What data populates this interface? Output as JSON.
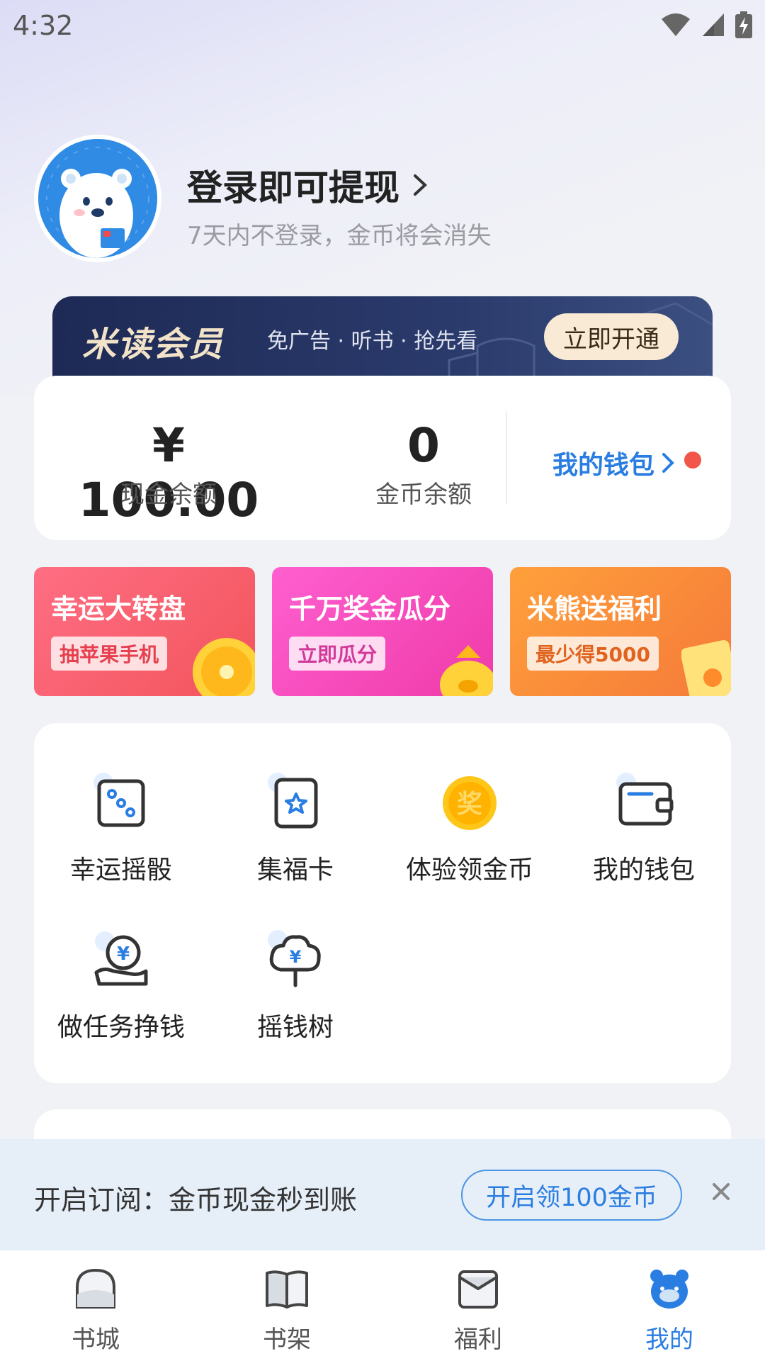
{
  "status_bar": {
    "time": "4:32"
  },
  "profile": {
    "login_title": "登录即可提现",
    "login_subtitle": "7天内不登录，金币将会消失"
  },
  "vip": {
    "title": "米读会员",
    "subtitle": "免广告 · 听书 · 抢先看",
    "button": "立即开通"
  },
  "balance": {
    "cash_amount": "¥ 100.00",
    "cash_label": "现金余额",
    "coin_amount": "0",
    "coin_label": "金币余额",
    "wallet_link": "我的钱包"
  },
  "promos": [
    {
      "title": "幸运大转盘",
      "tag": "抽苹果手机"
    },
    {
      "title": "千万奖金瓜分",
      "tag": "立即瓜分"
    },
    {
      "title": "米熊送福利",
      "tag": "最少得5000"
    }
  ],
  "features": [
    {
      "label": "幸运摇骰",
      "icon": "dice-icon"
    },
    {
      "label": "集福卡",
      "icon": "fortune-card-icon"
    },
    {
      "label": "体验领金币",
      "icon": "coin-reward-icon"
    },
    {
      "label": "我的钱包",
      "icon": "wallet-icon"
    },
    {
      "label": "做任务挣钱",
      "icon": "task-money-icon"
    },
    {
      "label": "摇钱树",
      "icon": "money-tree-icon"
    }
  ],
  "subscription": {
    "text": "开启订阅：金币现金秒到账",
    "button": "开启领100金币"
  },
  "nav": [
    {
      "label": "书城",
      "icon": "bookstore-icon"
    },
    {
      "label": "书架",
      "icon": "bookshelf-icon"
    },
    {
      "label": "福利",
      "icon": "welfare-icon"
    },
    {
      "label": "我的",
      "icon": "profile-bear-icon"
    }
  ],
  "colors": {
    "accent_blue": "#2a7de1",
    "vip_dark": "#1e2a55",
    "red_dot": "#f2554a"
  }
}
